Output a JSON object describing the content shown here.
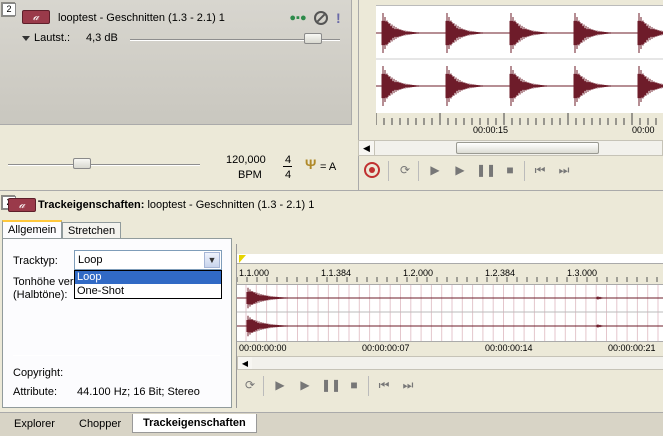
{
  "track": {
    "number": "2",
    "name": "looptest - Geschnitten (1.3 - 2.1) 1",
    "volume_label": "Lautst.:",
    "volume_value": "4,3 dB",
    "volume_level": 0.87
  },
  "tempo": {
    "bpm": "120,000",
    "bpm_unit": "BPM",
    "time_sig_top": "4",
    "time_sig_bottom": "4",
    "key": "= A"
  },
  "timeline_top": {
    "time_label": "00:00:15",
    "time_label_right": "00:00"
  },
  "props": {
    "number": "2",
    "title_bold": "Trackeigenschaften:",
    "title_rest": "looptest - Geschnitten (1.3 - 2.1) 1",
    "tabs": [
      "Allgemein",
      "Stretchen"
    ],
    "tracktyp_label": "Tracktyp:",
    "tracktyp_value": "Loop",
    "dropdown_options": [
      "Loop",
      "One-Shot"
    ],
    "pitch_label_1": "Tonhöhe ver",
    "pitch_label_2": "(Halbtöne):",
    "copyright_label": "Copyright:",
    "attribute_label": "Attribute:",
    "attribute_value": "44.100 Hz; 16 Bit; Stereo"
  },
  "ruler": {
    "beats": [
      "1.1.000",
      "1.1.384",
      "1.2.000",
      "1.2.384",
      "1.3.000"
    ],
    "times": [
      "00:00:00:00",
      "00:00:00:07",
      "00:00:00:14",
      "00:00:00:21"
    ]
  },
  "bottom_tabs": [
    "Explorer",
    "Chopper",
    "Trackeigenschaften"
  ],
  "colors": {
    "waveform": "#6e1c2a",
    "accent": "#ffc83c"
  }
}
